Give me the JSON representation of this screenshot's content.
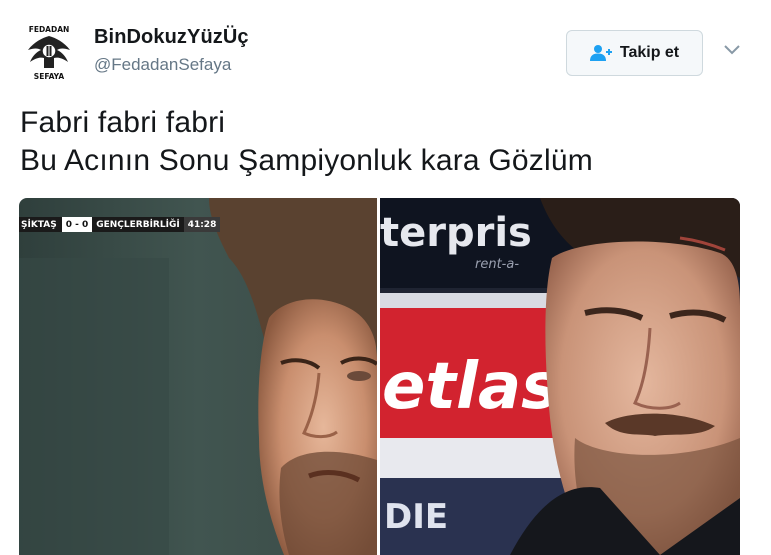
{
  "header": {
    "display_name": "BinDokuzYüzÜç",
    "handle": "@FedadanSefaya",
    "avatar_icon": "eagle-logo-icon",
    "avatar_text_top": "FEDADAN",
    "avatar_text_bottom": "SEFAYA"
  },
  "follow": {
    "label": "Takip et",
    "icon": "add-user-icon"
  },
  "menu": {
    "icon": "chevron-down-icon"
  },
  "tweet": {
    "lines": [
      "Fabri fabri fabri",
      "Bu Acının Sonu Şampiyonluk kara Gözlüm"
    ]
  },
  "media": {
    "left": {
      "scoreboard": {
        "team1": "ŞİKTAŞ",
        "score": "0 - 0",
        "team2": "GENÇLERBİRLİĞİ",
        "time": "41:28"
      }
    },
    "right": {
      "sign_top": "terpris",
      "sign_top_small": "rent-a-",
      "sign_middle": "etlas",
      "sign_bottom": "DIE"
    }
  },
  "colors": {
    "text": "#14171a",
    "secondary": "#657786",
    "accent": "#1da1f2"
  }
}
